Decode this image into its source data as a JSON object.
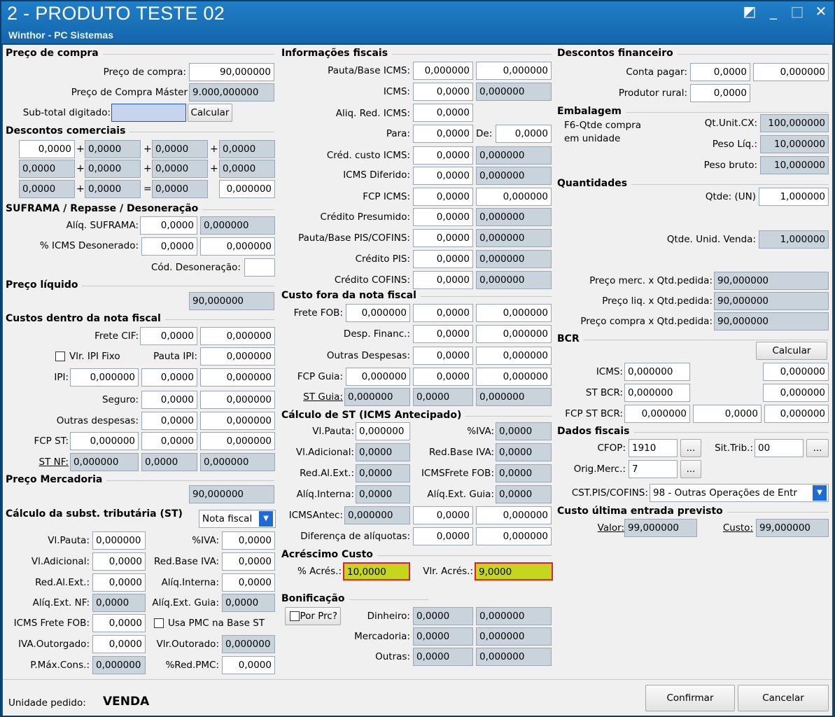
{
  "window": {
    "title": "2 - PRODUTO TESTE 02",
    "subtitle": "Winthor - PC Sistemas"
  },
  "preco_compra": {
    "title": "Preço de compra",
    "preco_label": "Preço de compra:",
    "preco": "90,000000",
    "master_label": "Preço de Compra Máster",
    "master": "9.000,000000",
    "subtotal_label": "Sub-total digitado:",
    "subtotal": "",
    "calcular": "Calcular"
  },
  "descontos": {
    "title": "Descontos comerciais",
    "r1": [
      "0,0000",
      "0,0000",
      "0,0000",
      "0,0000"
    ],
    "r2": [
      "0,0000",
      "0,0000",
      "0,0000",
      "0,0000"
    ],
    "r3": [
      "0,0000",
      "0,0000",
      "0,0000",
      "0,000000"
    ]
  },
  "suframa": {
    "title": "SUFRAMA / Repasse / Desoneração",
    "aliq_label": "Alíq. SUFRAMA:",
    "aliq1": "0,0000",
    "aliq2": "0,000000",
    "icms_label": "% ICMS Desonerado:",
    "icms1": "0,0000",
    "icms2": "0,000000",
    "cod_label": "Cód. Desoneração:",
    "cod": ""
  },
  "preco_liquido": {
    "title": "Preço líquido",
    "value": "90,000000"
  },
  "custos_nf": {
    "title": "Custos dentro da nota fiscal",
    "frete_label": "Frete CIF:",
    "frete1": "0,0000",
    "frete2": "0,000000",
    "ipi_fixo": "Vlr. IPI Fixo",
    "pauta_label": "Pauta IPI:",
    "pauta": "0,000000",
    "ipi_label": "IPI:",
    "ipi1": "0,000000",
    "ipi2": "0,0000",
    "ipi3": "0,000000",
    "seguro_label": "Seguro:",
    "seguro1": "0,0000",
    "seguro2": "0,000000",
    "outras_label": "Outras despesas:",
    "outras1": "0,0000",
    "outras2": "0,000000",
    "fcp_label": "FCP ST:",
    "fcp1": "0,000000",
    "fcp2": "0,0000",
    "fcp3": "0,000000",
    "stnf_label": "ST NF:",
    "stnf1": "0,000000",
    "stnf2": "0,0000",
    "stnf3": "0,000000"
  },
  "preco_merc": {
    "title": "Preço Mercadoria",
    "value": "90,000000"
  },
  "calc_st": {
    "title": "Cálculo da subst. tributária (ST)",
    "select": "Nota fiscal",
    "vlpauta_label": "Vl.Pauta:",
    "vlpauta": "0,000000",
    "iva_label": "%IVA:",
    "iva": "0,0000",
    "vladic_label": "Vl.Adicional:",
    "vladic": "0,0000",
    "redbase_label": "Red.Base IVA:",
    "redbase": "0,0000",
    "redal_label": "Red.Al.Ext.:",
    "redal": "0,0000",
    "aliqint_label": "Alíq.Interna:",
    "aliqint": "0,0000",
    "aliqnf_label": "Alíq.Ext. NF:",
    "aliqnf": "0,0000",
    "aliqguia_label": "Alíq.Ext. Guia:",
    "aliqguia": "0,0000",
    "icmsfrete_label": "ICMS Frete FOB:",
    "icmsfrete": "0,0000",
    "usapmc": "Usa PMC na Base ST",
    "ivaout_label": "IVA.Outorgado:",
    "ivaout": "0,0000",
    "vlrout_label": "Vlr.Outorado:",
    "vlrout": "0,000000",
    "pmax_label": "P.Máx.Cons.:",
    "pmax": "0,000000",
    "redpmc_label": "%Red.PMC:",
    "redpmc": "0,0000"
  },
  "info_fiscais": {
    "title": "Informações fiscais",
    "pauta_label": "Pauta/Base ICMS:",
    "pauta1": "0,000000",
    "pauta2": "0,000000",
    "icms_label": "ICMS:",
    "icms1": "0,0000",
    "icms2": "0,000000",
    "aliqred_label": "Aliq. Red. ICMS:",
    "aliqred": "0,0000",
    "para_label": "Para:",
    "para": "0,0000",
    "de_label": "De:",
    "de": "0,0000",
    "cred_label": "Créd. custo ICMS:",
    "cred1": "0,0000",
    "cred2": "0,000000",
    "dif_label": "ICMS Diferido:",
    "dif1": "0,0000",
    "dif2": "0,000000",
    "fcp_label": "FCP ICMS:",
    "fcp1": "0,0000",
    "fcp2": "0,000000",
    "presumido_label": "Crédito Presumido:",
    "pres1": "0,0000",
    "pres2": "0,000000",
    "pis_base_label": "Pauta/Base PIS/COFINS:",
    "pisb1": "0,0000",
    "pisb2": "0,000000",
    "cpis_label": "Crédito PIS:",
    "cpis1": "0,0000",
    "cpis2": "0,000000",
    "ccof_label": "Crédito COFINS:",
    "ccof1": "0,0000",
    "ccof2": "0,000000"
  },
  "custo_fora": {
    "title": "Custo fora da nota fiscal",
    "frete_label": "Frete FOB:",
    "frete1": "0,000000",
    "frete2": "0,0000",
    "frete3": "0,000000",
    "desp_label": "Desp. Financ.:",
    "desp1": "0,0000",
    "desp2": "0,000000",
    "outras_label": "Outras Despesas:",
    "outras1": "0,0000",
    "outras2": "0,000000",
    "fcp_label": "FCP Guia:",
    "fcp1": "0,000000",
    "fcp2": "0,0000",
    "fcp3": "0,000000",
    "st_label": "ST Guia:",
    "st1": "0,000000",
    "st2": "0,0000",
    "st3": "0,000000"
  },
  "calc_st_ant": {
    "title": "Cálculo de ST (ICMS Antecipado)",
    "vlpauta_label": "Vl.Pauta:",
    "vlpauta": "0,000000",
    "iva_label": "%IVA:",
    "iva": "0,0000",
    "vladic_label": "Vl.Adicional:",
    "vladic": "0,0000",
    "redbase_label": "Red.Base IVA:",
    "redbase": "0,0000",
    "redal_label": "Red.Al.Ext.:",
    "redal": "0,0000",
    "icmsfrete_label": "ICMSFrete FOB:",
    "icmsfrete": "0,0000",
    "aliqint_label": "Alíq.Interna:",
    "aliqint": "0,0000",
    "aliqguia_label": "Alíq.Ext. Guia:",
    "aliqguia": "0,0000",
    "antec_label": "ICMSAntec:",
    "antec1": "0,000000",
    "antec2": "0,0000",
    "antec3": "0,000000",
    "dif_label": "Diferença de alíquotas:",
    "dif1": "0,0000",
    "dif2": "0,000000"
  },
  "acrescimo": {
    "title": "Acréscimo Custo",
    "perc_label": "% Acrés.:",
    "perc": "10,0000",
    "vlr_label": "Vlr. Acrés.:",
    "vlr": "9,0000"
  },
  "bonificacao": {
    "title": "Bonificação",
    "por_prc": "Por Prc?",
    "din_label": "Dinheiro:",
    "din1": "0,0000",
    "din2": "0,000000",
    "merc_label": "Mercadoria:",
    "merc1": "0,0000",
    "merc2": "0,000000",
    "outras_label": "Outras:",
    "outras1": "0,0000",
    "outras2": "0,000000"
  },
  "desc_fin": {
    "title": "Descontos financeiro",
    "conta_label": "Conta pagar:",
    "conta1": "0,0000",
    "conta2": "0,000000",
    "prod_label": "Produtor rural:",
    "prod": "0,0000"
  },
  "embalagem": {
    "title": "Embalagem",
    "f6": "F6-Qtde compra em unidade",
    "qtunit_label": "Qt.Unit.CX:",
    "qtunit": "100,000000",
    "pesoliq_label": "Peso Líq.:",
    "pesoliq": "10,000000",
    "pesobruto_label": "Peso bruto:",
    "pesobruto": "10,000000"
  },
  "quantidades": {
    "title": "Quantidades",
    "qtde_label": "Qtde: (UN)",
    "qtde": "1,000000",
    "qtdevenda_label": "Qtde. Unid. Venda:",
    "qtdevenda": "1,000000"
  },
  "precos_calc": {
    "merc_label": "Preço merc. x Qtd.pedida:",
    "merc": "90,000000",
    "liq_label": "Preço liq. x Qtd.pedida:",
    "liq": "90,000000",
    "compra_label": "Preço compra x Qtd.pedida:",
    "compra": "90,000000"
  },
  "bcr": {
    "title": "BCR",
    "calcular": "Calcular",
    "icms_label": "ICMS:",
    "icms1": "0,000000",
    "icms2": "0,000000",
    "st_label": "ST BCR:",
    "st1": "0,000000",
    "st2": "0,000000",
    "fcp_label": "FCP ST BCR:",
    "fcp1": "0,000000",
    "fcp2": "0,0000",
    "fcp3": "0,000000"
  },
  "dados_fiscais": {
    "title": "Dados fiscais",
    "cfop_label": "CFOP:",
    "cfop": "1910",
    "sit_label": "Sit.Trib.:",
    "sit": "00",
    "orig_label": "Orig.Merc.:",
    "orig": "7",
    "cst_label": "CST.PIS/COFINS:",
    "cst": "98 - Outras Operações de Entr",
    "ellipsis": "..."
  },
  "custo_ultima": {
    "title": "Custo última entrada previsto",
    "valor_label": "Valor:",
    "valor": "99,000000",
    "custo_label": "Custo:",
    "custo": "99,000000"
  },
  "footer": {
    "unidade_label": "Unidade pedido:",
    "unidade": "VENDA",
    "confirmar": "Confirmar",
    "cancelar": "Cancelar"
  }
}
